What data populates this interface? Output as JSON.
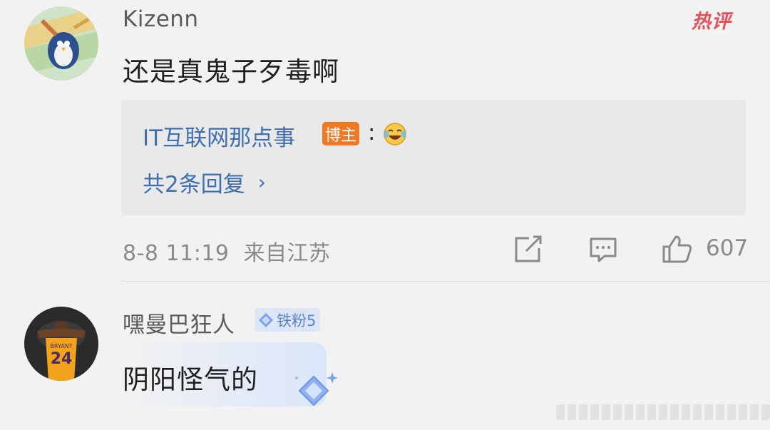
{
  "hot_badge": "热评",
  "comments": [
    {
      "username": "Kizenn",
      "text": "还是真鬼子歹毒啊",
      "reply": {
        "author": "IT互联网那点事",
        "badge": "博主",
        "colon": ":",
        "emoji": "laughing-crying-emoji",
        "more_label": "共2条回复",
        "more_chevron": "›"
      },
      "meta": "8-8 11:19  来自江苏",
      "likes": "607"
    },
    {
      "username": "嘿曼巴狂人",
      "fan_badge": "铁粉5",
      "text": "阴阳怪气的"
    }
  ],
  "icons": {
    "share": "share-icon",
    "comment": "comment-icon",
    "like": "thumbs-up-icon"
  },
  "colors": {
    "link": "#3f6fae",
    "blogger_badge": "#ef7a25",
    "hot": "#e2515a",
    "fan_badge_bg": "#dde6f5"
  }
}
